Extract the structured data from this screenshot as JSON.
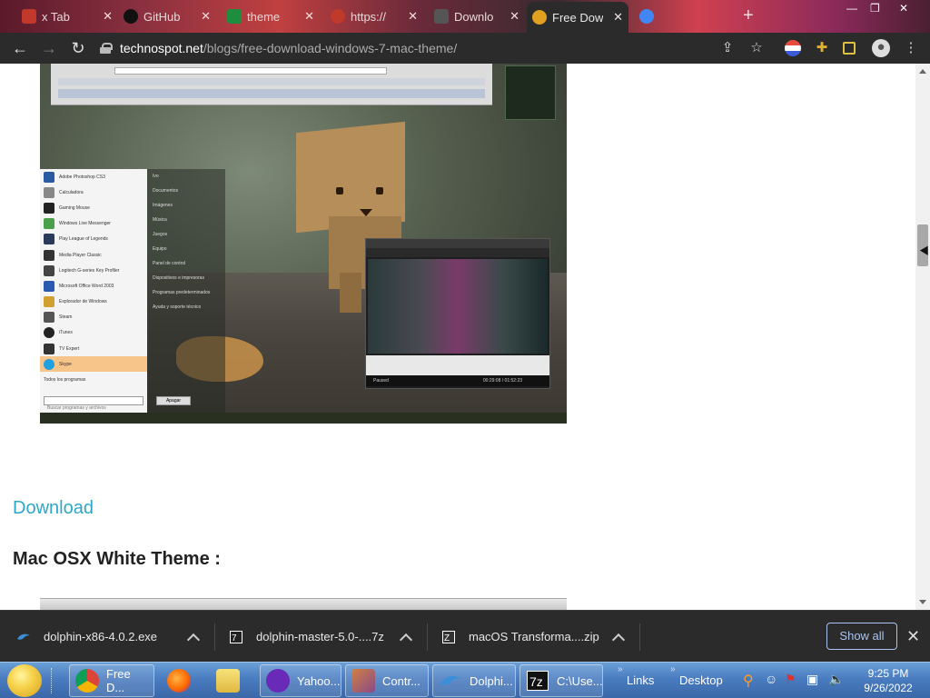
{
  "tabs": [
    {
      "label": "x Tab",
      "icon": "tab-icon",
      "color": "#c0392b"
    },
    {
      "label": "GitHub",
      "icon": "github-icon",
      "color": "#111111"
    },
    {
      "label": "theme",
      "icon": "sheets-icon",
      "color": "#1e8e3e"
    },
    {
      "label": "https://",
      "icon": "site-icon",
      "color": "#c0392b"
    },
    {
      "label": "Downlo",
      "icon": "download-site-icon",
      "color": "#555555"
    },
    {
      "label": "Free Dow",
      "icon": "technospot-icon",
      "color": "#e0a020",
      "active": true
    },
    {
      "label": "",
      "icon": "google-icon",
      "color": "#4285f4"
    }
  ],
  "address": {
    "domain": "technospot.net",
    "path": "/blogs/free-download-windows-7-mac-theme/"
  },
  "article": {
    "download_link": "Download",
    "section_heading": "Mac OSX White Theme :"
  },
  "screenshot_start_menu": [
    "Adobe Photoshop CS3",
    "Calculadora",
    "Gaming Mouse",
    "Windows Live Messenger",
    "Play League of Legends",
    "Media Player Classic",
    "Logitech G-series Key Profiler",
    "Microsoft Office Word 2003",
    "Explorador de Windows",
    "Steam",
    "iTunes",
    "TV Expert",
    "Skype"
  ],
  "screenshot_right_pane": [
    "Ivo",
    "Documentos",
    "Imágenes",
    "Música",
    "Juegos",
    "Equipo",
    "Panel de control",
    "Dispositivos e impresoras",
    "Programas predeterminados",
    "Ayuda y soporte técnico"
  ],
  "screenshot_misc": {
    "all_programs": "Todos los programas",
    "search_placeholder": "Buscar programas y archivos",
    "shutdown": "Apagar",
    "player_status": "Paused",
    "player_time": "00:29:08 / 01:52:23"
  },
  "downloads": [
    {
      "name": "dolphin-x86-4.0.2.exe",
      "icon": "dolphin-icon"
    },
    {
      "name": "dolphin-master-5.0-....7z",
      "icon": "7z-archive-icon"
    },
    {
      "name": "macOS Transforma....zip",
      "icon": "zip-archive-icon"
    }
  ],
  "download_shelf": {
    "show_all": "Show all"
  },
  "taskbar": {
    "buttons": [
      {
        "label": "Free D...",
        "icon": "chrome-icon"
      },
      {
        "label": "",
        "icon": "firefox-icon"
      },
      {
        "label": "",
        "icon": "folder-icon"
      },
      {
        "label": "Yahoo...",
        "icon": "yahoo-icon"
      },
      {
        "label": "Contr...",
        "icon": "control-panel-icon"
      },
      {
        "label": "Dolphi...",
        "icon": "dolphin-icon"
      },
      {
        "label": "C:\\Use...",
        "icon": "7zip-icon"
      }
    ],
    "links": "Links",
    "desktop": "Desktop",
    "time": "9:25 PM",
    "date": "9/26/2022"
  }
}
